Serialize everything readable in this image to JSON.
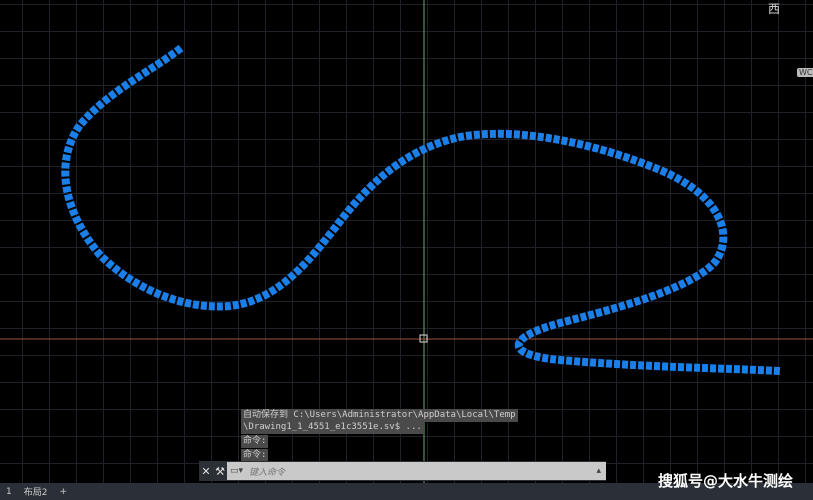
{
  "history": [
    "自动保存到 C:\\Users\\Administrator\\AppData\\Local\\Temp",
    "\\Drawing1_1_4551_e1c3551e.sv$ ...",
    "命令:",
    "命令:"
  ],
  "command": {
    "placeholder": "键入命令",
    "close": "✕",
    "wrench": "🔧"
  },
  "tabs": [
    "1",
    "布局2",
    "+"
  ],
  "viewcube": {
    "label": "西",
    "wcs": "WC"
  },
  "watermark": "搜狐号@大水牛测绘",
  "colors": {
    "curve": "#1a7fe8",
    "crosshair_v": "#6fa86f",
    "crosshair_h": "#a0523a"
  }
}
